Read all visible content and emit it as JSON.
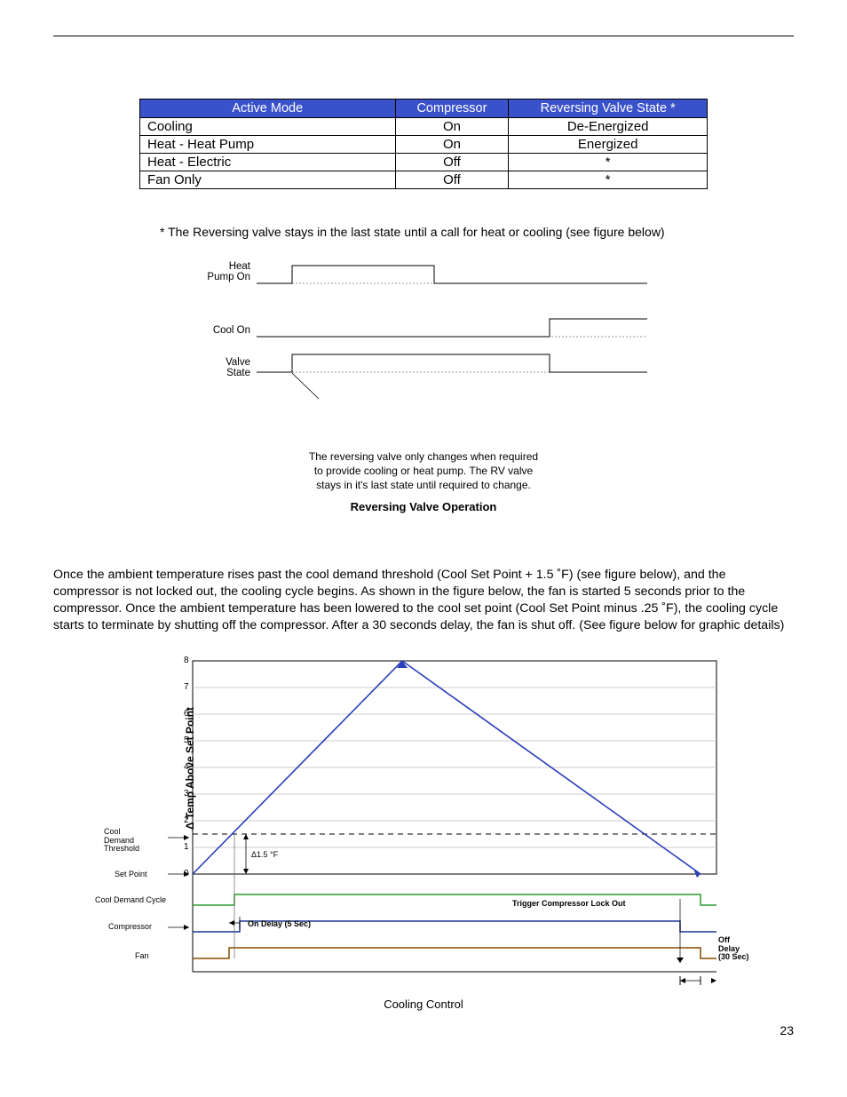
{
  "table": {
    "headers": [
      "Active Mode",
      "Compressor",
      "Reversing Valve State  *"
    ],
    "rows": [
      [
        "Cooling",
        "On",
        "De-Energized"
      ],
      [
        "Heat - Heat Pump",
        "On",
        "Energized"
      ],
      [
        "Heat - Electric",
        "Off",
        "*"
      ],
      [
        "Fan Only",
        "Off",
        "*"
      ]
    ]
  },
  "footnote": "* The Reversing valve stays in the last state until a call for heat or cooling (see figure below)",
  "diagram1": {
    "labels": {
      "heat": "Heat\nPump On",
      "cool": "Cool On",
      "valve": "Valve\nState"
    },
    "note_l1": "The reversing valve only changes when required",
    "note_l2": "to provide cooling or heat pump. The RV valve",
    "note_l3": "stays in it's last state until required to change.",
    "caption": "Reversing Valve Operation"
  },
  "paragraph": "Once the ambient temperature rises past the cool demand threshold (Cool Set Point + 1.5 ˚F) (see figure below), and the compressor is not locked out, the cooling cycle begins. As shown in the figure below, the fan is started 5 seconds prior to the compressor. Once the ambient temperature has been lowered to the cool set point (Cool Set Point minus .25 ˚F), the cooling cycle starts to terminate by shutting off the compressor. After a 30 seconds delay, the fan is shut off. (See figure below for graphic details)",
  "chart_data": {
    "type": "line",
    "title": "Cooling Control",
    "ylabel": "Δ Temp Above Set Point",
    "ylim": [
      0,
      8
    ],
    "y_ticks": [
      0,
      1,
      2,
      3,
      4,
      5,
      6,
      7,
      8
    ],
    "annotations": {
      "cool_demand_threshold": "Cool\nDemand\nThreshold",
      "set_point": "Set Point",
      "cool_demand_cycle": "Cool Demand Cycle",
      "compressor": "Compressor",
      "fan": "Fan",
      "delta_label": "Δ1.5 °F",
      "on_delay": "On Delay (5 Sec)",
      "trigger": "Trigger Compressor Lock Out",
      "off_delay": "Off\nDelay\n(30 Sec)"
    },
    "temp_series": {
      "x_fraction": [
        0,
        0.4,
        0.97
      ],
      "y": [
        0,
        8,
        0
      ]
    },
    "threshold_y": 1.5,
    "cool_demand_cycle": {
      "on_x": 0.08,
      "off_x": 0.97
    },
    "compressor": {
      "on_x": 0.09,
      "off_x": 0.93
    },
    "fan": {
      "on_x": 0.07,
      "off_x": 0.97
    }
  },
  "page_number": "23"
}
